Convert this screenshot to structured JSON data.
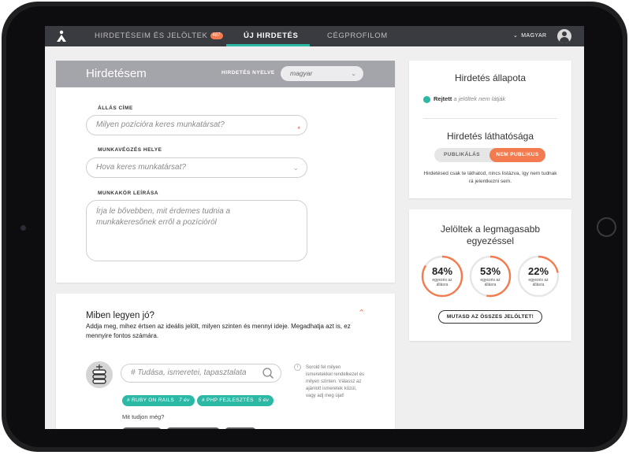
{
  "nav": {
    "items": [
      {
        "label": "HIRDETÉSEIM ÉS JELÖLTEK",
        "badge": "487"
      },
      {
        "label": "ÚJ HIRDETÉS"
      },
      {
        "label": "CÉGPROFILOM"
      }
    ],
    "language": "MAGYAR",
    "active_index": 1
  },
  "ad_form": {
    "title": "Hirdetésem",
    "language_label": "HIRDETÉS NYELVE",
    "language_value": "magyar",
    "job_title": {
      "label": "ÁLLÁS CÍME",
      "placeholder": "Milyen pozícióra keres munkatársat?",
      "required_mark": "*"
    },
    "location": {
      "label": "MUNKAVÉGZÉS HELYE",
      "placeholder": "Hova keres munkatársat?"
    },
    "description": {
      "label": "MUNKAKÖR LEÍRÁSA",
      "placeholder": "Írja le bővebben, mit érdemes tudnia a munkakeresőnek erről a pozícióról"
    }
  },
  "skills": {
    "title": "Miben legyen jó?",
    "description": "Addja meg, mihez értsen az ideális jelölt, milyen szinten és mennyi ideje. Megadhatja azt is, ez mennyire fontos számára.",
    "search_placeholder": "# Tudása, ismeretei, tapasztalata",
    "info_text": "Sorold fel milyen ismeretekkel rendelkezel és milyen szinten. Válassz az ajánlott ismeretek közül, vagy adj meg újat!",
    "chips": [
      {
        "label": "# RUBY ON RAILS",
        "years": "7 év"
      },
      {
        "label": "# PHP FEJLESZTÉS",
        "years": "5 év"
      }
    ],
    "more_label": "Mit tudjon még?"
  },
  "status_card": {
    "title": "Hirdetés állapota",
    "status": "Rejtett",
    "status_note": "a jelöltek nem látják",
    "visibility_title": "Hirdetés láthatósága",
    "options": [
      "PUBLIKÁLÁS",
      "NEM PUBLIKUS"
    ],
    "selected_option": 1,
    "visibility_desc": "Hirdetésed csak te láthatod, nincs listázva, így nem tudnak rá jelentkezni sem."
  },
  "match_card": {
    "title": "Jelöltek a legmagasabb egyezéssel",
    "matches": [
      {
        "percent": "84%",
        "value": 0.84,
        "label": "egyezés az állásra"
      },
      {
        "percent": "53%",
        "value": 0.53,
        "label": "egyezés az állásra"
      },
      {
        "percent": "22%",
        "value": 0.22,
        "label": "egyezés az állásra"
      }
    ],
    "button": "MUTASD AZ ÖSSZES JELÖLTET!"
  },
  "colors": {
    "accent": "#f47b4f",
    "teal": "#2bb9a6",
    "nav_bg": "#3a3b40"
  }
}
